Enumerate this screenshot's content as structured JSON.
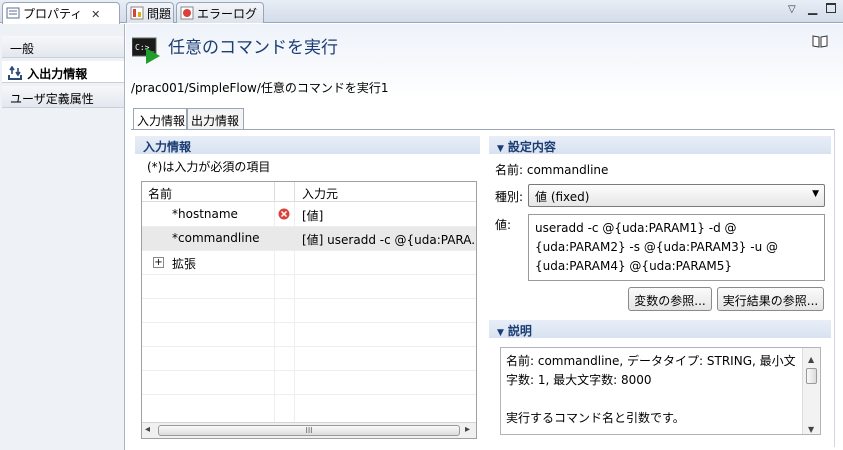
{
  "tabs": [
    {
      "label": "プロパティ"
    },
    {
      "label": "問題"
    },
    {
      "label": "エラーログ"
    }
  ],
  "header": {
    "title": "任意のコマンドを実行",
    "path": "/prac001/SimpleFlow/任意のコマンドを実行1"
  },
  "sidebar": {
    "items": [
      {
        "label": "一般"
      },
      {
        "label": "入出力情報"
      },
      {
        "label": "ユーザ定義属性"
      }
    ]
  },
  "subtabs": [
    {
      "label": "入力情報"
    },
    {
      "label": "出力情報"
    }
  ],
  "input_section": {
    "title": "入力情報",
    "note": "(*)は入力が必須の項目",
    "columns": {
      "name": "名前",
      "source": "入力元"
    },
    "rows": [
      {
        "name": "*hostname",
        "source": "[値]"
      },
      {
        "name": "*commandline",
        "source": "[値] useradd -c @{uda:PARA..."
      },
      {
        "name": "拡張",
        "source": ""
      }
    ]
  },
  "settings": {
    "title": "設定内容",
    "name_label": "名前: commandline",
    "type_label": "種別:",
    "type_value": "値 (fixed)",
    "value_label": "値:",
    "value_lines": [
      "useradd -c @{uda:PARAM1} -d @",
      "{uda:PARAM2} -s @{uda:PARAM3} -u @",
      "{uda:PARAM4} @{uda:PARAM5}"
    ],
    "btn_variables": "変数の参照...",
    "btn_results": "実行結果の参照..."
  },
  "description": {
    "title": "説明",
    "lines": [
      "名前: commandline, データタイプ: STRING, 最小文",
      "字数: 1, 最大文字数: 8000",
      "",
      "実行するコマンド名と引数です。"
    ]
  },
  "hscroll_grip": "III",
  "cmd_icon_text": "C:>_",
  "colors": {
    "accent": "#1b3d74",
    "error": "#d9413a"
  }
}
